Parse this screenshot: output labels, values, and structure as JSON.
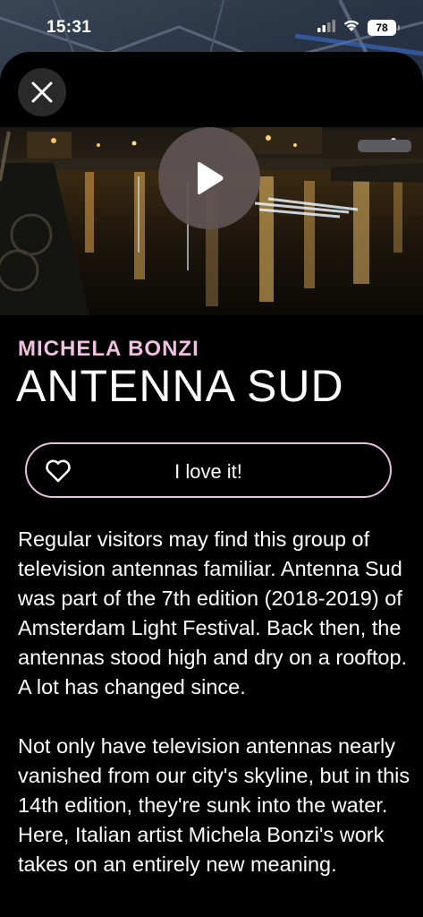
{
  "status_bar": {
    "time": "15:31",
    "battery": "78",
    "icons": [
      "signal-icon",
      "wifi-icon",
      "battery-icon"
    ]
  },
  "sheet": {
    "close_icon": "close-icon",
    "media": {
      "play_icon": "play-icon"
    },
    "artist": "MICHELA BONZI",
    "title": "ANTENNA SUD",
    "love_button": {
      "icon": "heart-icon",
      "label": "I love it!"
    },
    "description": [
      "Regular visitors may find this group of television antennas familiar. Antenna Sud was part of the 7th edition (2018-2019) of Amsterdam Light Festival. Back then, the antennas stood high and dry on a rooftop. A lot has changed since.",
      "Not only have television antennas nearly vanished from our city's skyline, but in this 14th edition, they're sunk into the water. Here, Italian artist Michela Bonzi's work takes on an entirely new meaning."
    ]
  },
  "colors": {
    "accent_pink": "#f2bfe3",
    "button_border": "#e9bfe0",
    "background": "#000000",
    "text": "#ffffff"
  }
}
